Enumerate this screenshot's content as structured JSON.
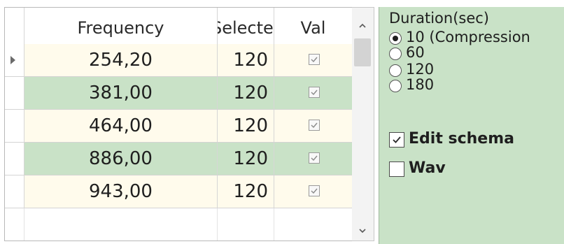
{
  "grid": {
    "columns": [
      "Frequency",
      "Selected",
      "Val"
    ],
    "rows": [
      {
        "frequency": "254,20",
        "selected": "120",
        "val": true,
        "current": true
      },
      {
        "frequency": "381,00",
        "selected": "120",
        "val": true,
        "current": false
      },
      {
        "frequency": "464,00",
        "selected": "120",
        "val": true,
        "current": false
      },
      {
        "frequency": "886,00",
        "selected": "120",
        "val": true,
        "current": false
      },
      {
        "frequency": "943,00",
        "selected": "120",
        "val": true,
        "current": false
      }
    ]
  },
  "duration": {
    "title": "Duration(sec)",
    "options": [
      {
        "label": "10 (Compression",
        "checked": true
      },
      {
        "label": "60",
        "checked": false
      },
      {
        "label": "120",
        "checked": false
      },
      {
        "label": "180",
        "checked": false
      }
    ]
  },
  "edit_schema": {
    "label": "Edit schema",
    "checked": true
  },
  "wav": {
    "label": "Wav",
    "checked": false
  },
  "colors": {
    "row_odd": "#fffbec",
    "row_even": "#c9e2c7",
    "panel": "#c9e2c7"
  },
  "icons": {
    "row_indicator": "row-indicator-icon",
    "scroll_up": "scroll-up-icon",
    "scroll_down": "scroll-down-icon",
    "checkmark": "checkmark-icon"
  }
}
